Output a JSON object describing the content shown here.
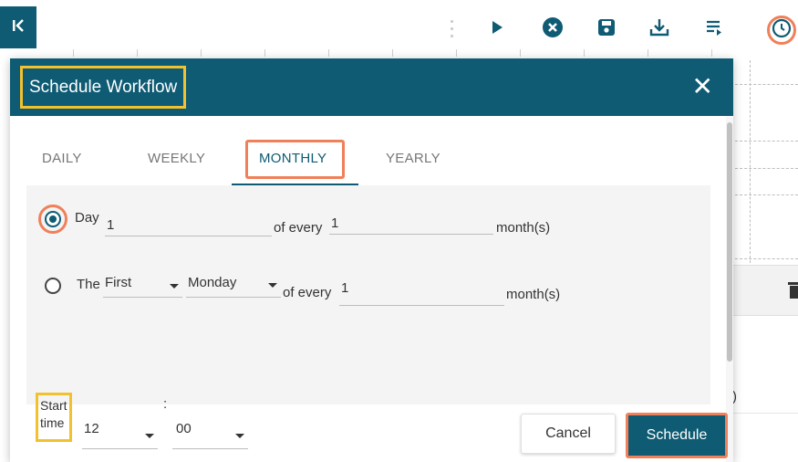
{
  "toolbar": {
    "collapse_label": "K",
    "icons": [
      "run-icon",
      "stop-icon",
      "save-icon",
      "download-icon",
      "list-icon",
      "schedule-clock-icon"
    ]
  },
  "modal": {
    "title": "Schedule Workflow",
    "close_symbol": "✕",
    "tabs": [
      "DAILY",
      "WEEKLY",
      "MONTHLY",
      "YEARLY"
    ],
    "active_tab": "MONTHLY",
    "option_day": {
      "label": "Day",
      "day_value": "1",
      "of_every_label": "of every",
      "month_value": "1",
      "unit": "month(s)",
      "selected": true
    },
    "option_the": {
      "label": "The",
      "ordinal_value": "First",
      "weekday_value": "Monday",
      "of_every_label": "of every",
      "month_value": "1",
      "unit": "month(s)",
      "selected": false
    },
    "start_time": {
      "label_line1": "Start",
      "label_line2": "time",
      "separator": ":",
      "hour_value": "12",
      "minute_value": "00"
    },
    "buttons": {
      "cancel": "Cancel",
      "schedule": "Schedule"
    }
  },
  "background": {
    "partial_text": ")"
  },
  "colors": {
    "primary": "#0e5b73",
    "highlight_yellow": "#f2c12e",
    "highlight_orange": "#f0805a"
  }
}
